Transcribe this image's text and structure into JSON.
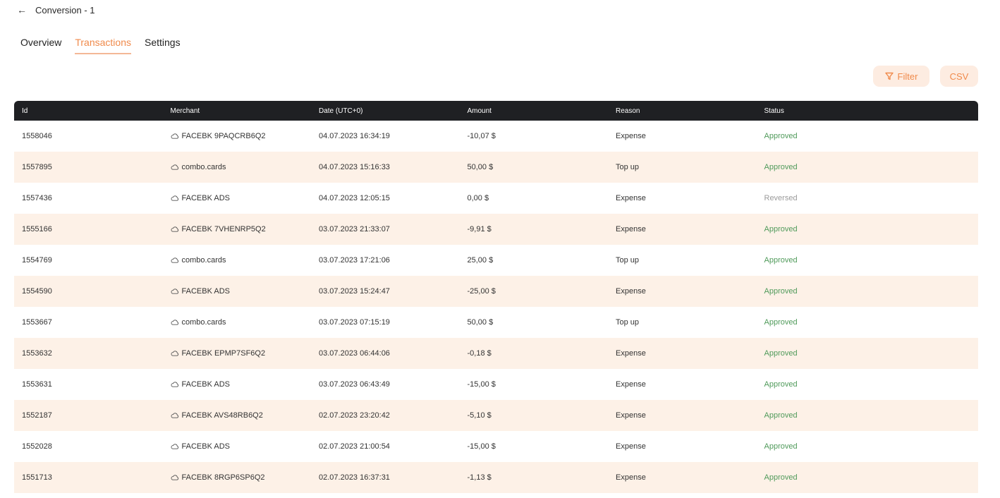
{
  "header": {
    "back_icon": "arrow-left-icon",
    "title": "Conversion - 1"
  },
  "tabs": [
    {
      "label": "Overview",
      "active": false
    },
    {
      "label": "Transactions",
      "active": true
    },
    {
      "label": "Settings",
      "active": false
    }
  ],
  "toolbar": {
    "filter_label": "Filter",
    "csv_label": "CSV"
  },
  "table": {
    "columns": [
      "Id",
      "Merchant",
      "Date (UTC+0)",
      "Amount",
      "Reason",
      "Status"
    ],
    "rows": [
      {
        "id": "1558046",
        "merchant": "FACEBK 9PAQCRB6Q2",
        "date": "04.07.2023 16:34:19",
        "amount": "-10,07 $",
        "reason": "Expense",
        "status": "Approved"
      },
      {
        "id": "1557895",
        "merchant": "combo.cards",
        "date": "04.07.2023 15:16:33",
        "amount": "50,00 $",
        "reason": "Top up",
        "status": "Approved"
      },
      {
        "id": "1557436",
        "merchant": "FACEBK ADS",
        "date": "04.07.2023 12:05:15",
        "amount": "0,00 $",
        "reason": "Expense",
        "status": "Reversed"
      },
      {
        "id": "1555166",
        "merchant": "FACEBK 7VHENRP5Q2",
        "date": "03.07.2023 21:33:07",
        "amount": "-9,91 $",
        "reason": "Expense",
        "status": "Approved"
      },
      {
        "id": "1554769",
        "merchant": "combo.cards",
        "date": "03.07.2023 17:21:06",
        "amount": "25,00 $",
        "reason": "Top up",
        "status": "Approved"
      },
      {
        "id": "1554590",
        "merchant": "FACEBK ADS",
        "date": "03.07.2023 15:24:47",
        "amount": "-25,00 $",
        "reason": "Expense",
        "status": "Approved"
      },
      {
        "id": "1553667",
        "merchant": "combo.cards",
        "date": "03.07.2023 07:15:19",
        "amount": "50,00 $",
        "reason": "Top up",
        "status": "Approved"
      },
      {
        "id": "1553632",
        "merchant": "FACEBK EPMP7SF6Q2",
        "date": "03.07.2023 06:44:06",
        "amount": "-0,18 $",
        "reason": "Expense",
        "status": "Approved"
      },
      {
        "id": "1553631",
        "merchant": "FACEBK ADS",
        "date": "03.07.2023 06:43:49",
        "amount": "-15,00 $",
        "reason": "Expense",
        "status": "Approved"
      },
      {
        "id": "1552187",
        "merchant": "FACEBK AVS48RB6Q2",
        "date": "02.07.2023 23:20:42",
        "amount": "-5,10 $",
        "reason": "Expense",
        "status": "Approved"
      },
      {
        "id": "1552028",
        "merchant": "FACEBK ADS",
        "date": "02.07.2023 21:00:54",
        "amount": "-15,00 $",
        "reason": "Expense",
        "status": "Approved"
      },
      {
        "id": "1551713",
        "merchant": "FACEBK 8RGP6SP6Q2",
        "date": "02.07.2023 16:37:31",
        "amount": "-1,13 $",
        "reason": "Expense",
        "status": "Approved"
      }
    ]
  },
  "colors": {
    "accent": "#f08a4b",
    "approved": "#4f9a5a",
    "reversed": "#9b9b9b",
    "row_alt": "#fdf1e7",
    "header_bg": "#1f2023"
  },
  "icons": {
    "merchant": "cloud-icon",
    "filter": "filter-icon"
  }
}
